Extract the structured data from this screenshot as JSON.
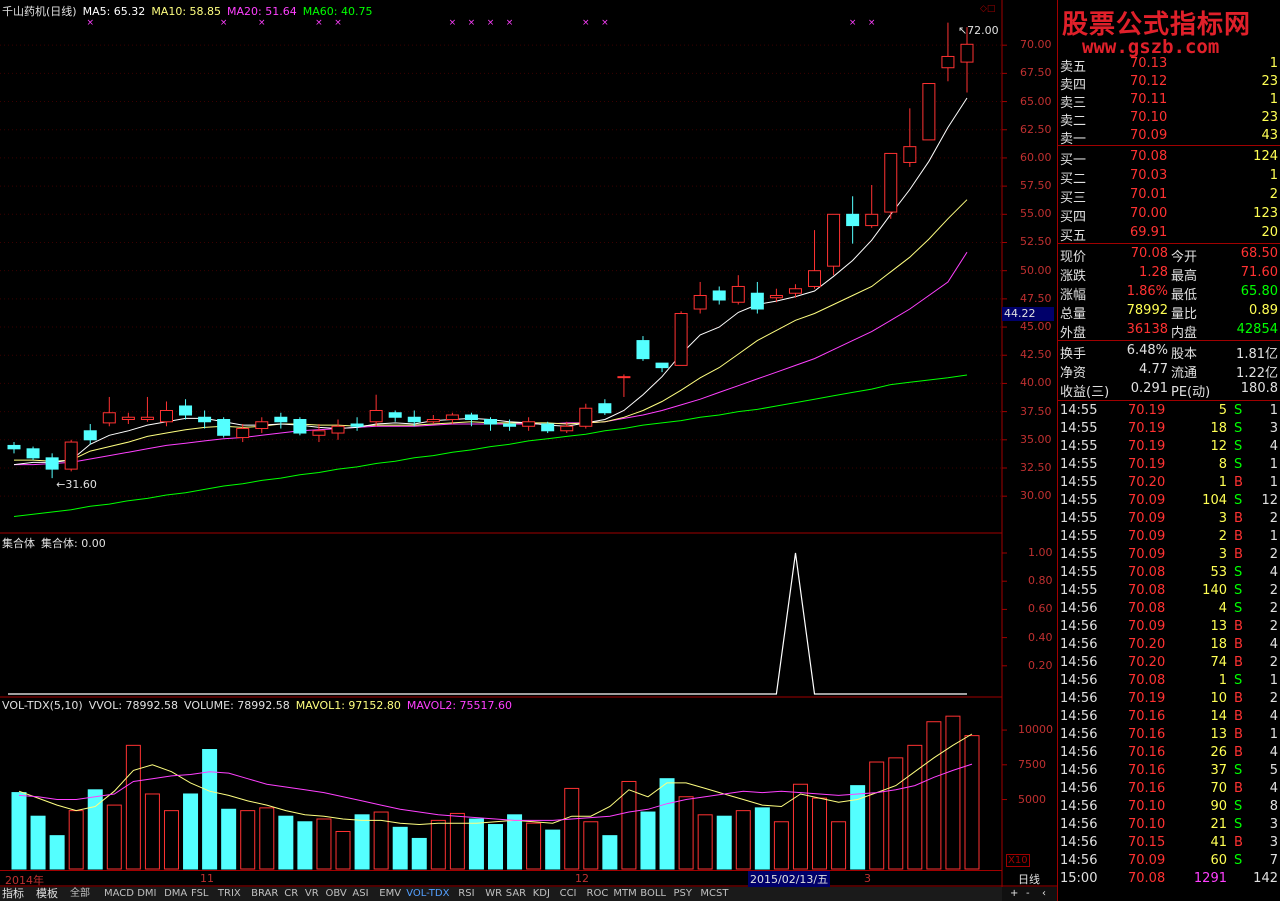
{
  "kline_header": {
    "name": "千山药机(日线)",
    "ma5": "MA5: 65.32",
    "ma10": "MA10: 58.85",
    "ma20": "MA20: 51.64",
    "ma60": "MA60: 40.75"
  },
  "high_label": "72.00",
  "low_label": "31.60",
  "cursor_price": "44.22",
  "price_ticks": [
    "70.00",
    "67.50",
    "65.00",
    "62.50",
    "60.00",
    "57.50",
    "55.00",
    "52.50",
    "50.00",
    "47.50",
    "45.00",
    "42.50",
    "40.00",
    "37.50",
    "35.00",
    "32.50",
    "30.00"
  ],
  "ind_header": {
    "name": "集合体",
    "value": "集合体: 0.00"
  },
  "ind_ticks": [
    "1.00",
    "0.80",
    "0.60",
    "0.40",
    "0.20"
  ],
  "vol_header": {
    "name": "VOL-TDX(5,10)",
    "vvol": "VVOL: 78992.58",
    "volume": "VOLUME: 78992.58",
    "mavol1": "MAVOL1: 97152.80",
    "mavol2": "MAVOL2: 75517.60"
  },
  "vol_ticks": [
    "10000",
    "7500",
    "5000"
  ],
  "vol_unit": "X10",
  "date_labels": {
    "year": "2014年",
    "m11": "11",
    "m12": "12",
    "cursor": "2015/02/13/五",
    "m3": "3"
  },
  "period": "日线",
  "watermark": {
    "line1": "股票公式指标网",
    "line2": "www.gszb.com"
  },
  "colors": {
    "up": "#ff3232",
    "down": "#54ffff",
    "ma5": "#ffffff",
    "ma10": "#ffff80",
    "ma20": "#ff40ff",
    "ma60": "#00ff00"
  },
  "sell": [
    {
      "label": "卖五",
      "price": "70.13",
      "vol": "1"
    },
    {
      "label": "卖四",
      "price": "70.12",
      "vol": "23"
    },
    {
      "label": "卖三",
      "price": "70.11",
      "vol": "1"
    },
    {
      "label": "卖二",
      "price": "70.10",
      "vol": "23"
    },
    {
      "label": "卖一",
      "price": "70.09",
      "vol": "43"
    }
  ],
  "buy": [
    {
      "label": "买一",
      "price": "70.08",
      "vol": "124"
    },
    {
      "label": "买二",
      "price": "70.03",
      "vol": "1"
    },
    {
      "label": "买三",
      "price": "70.01",
      "vol": "2"
    },
    {
      "label": "买四",
      "price": "70.00",
      "vol": "123"
    },
    {
      "label": "买五",
      "price": "69.91",
      "vol": "20"
    }
  ],
  "quote": [
    {
      "l1": "现价",
      "v1": "70.08",
      "l2": "今开",
      "v2": "68.50"
    },
    {
      "l1": "涨跌",
      "v1": "1.28",
      "l2": "最高",
      "v2": "71.60"
    },
    {
      "l1": "涨幅",
      "v1": "1.86%",
      "l2": "最低",
      "v2": "65.80"
    },
    {
      "l1": "总量",
      "v1": "78992",
      "l2": "量比",
      "v2": "0.89"
    },
    {
      "l1": "外盘",
      "v1": "36138",
      "l2": "内盘",
      "v2": "42854"
    }
  ],
  "fin": [
    {
      "l1": "换手",
      "v1": "6.48%",
      "l2": "股本",
      "v2": "1.81亿"
    },
    {
      "l1": "净资",
      "v1": "4.77",
      "l2": "流通",
      "v2": "1.22亿"
    },
    {
      "l1": "收益(三)",
      "v1": "0.291",
      "l2": "PE(动)",
      "v2": "180.8"
    }
  ],
  "ticks": [
    {
      "t": "14:55",
      "p": "70.19",
      "v": "5",
      "d": "S",
      "n": "1"
    },
    {
      "t": "14:55",
      "p": "70.19",
      "v": "18",
      "d": "S",
      "n": "3"
    },
    {
      "t": "14:55",
      "p": "70.19",
      "v": "12",
      "d": "S",
      "n": "4"
    },
    {
      "t": "14:55",
      "p": "70.19",
      "v": "8",
      "d": "S",
      "n": "1"
    },
    {
      "t": "14:55",
      "p": "70.20",
      "v": "1",
      "d": "B",
      "n": "1"
    },
    {
      "t": "14:55",
      "p": "70.09",
      "v": "104",
      "d": "S",
      "n": "12"
    },
    {
      "t": "14:55",
      "p": "70.09",
      "v": "3",
      "d": "B",
      "n": "2"
    },
    {
      "t": "14:55",
      "p": "70.09",
      "v": "2",
      "d": "B",
      "n": "1"
    },
    {
      "t": "14:55",
      "p": "70.09",
      "v": "3",
      "d": "B",
      "n": "2"
    },
    {
      "t": "14:55",
      "p": "70.08",
      "v": "53",
      "d": "S",
      "n": "4"
    },
    {
      "t": "14:55",
      "p": "70.08",
      "v": "140",
      "d": "S",
      "n": "2"
    },
    {
      "t": "14:56",
      "p": "70.08",
      "v": "4",
      "d": "S",
      "n": "2"
    },
    {
      "t": "14:56",
      "p": "70.09",
      "v": "13",
      "d": "B",
      "n": "2"
    },
    {
      "t": "14:56",
      "p": "70.20",
      "v": "18",
      "d": "B",
      "n": "4"
    },
    {
      "t": "14:56",
      "p": "70.20",
      "v": "74",
      "d": "B",
      "n": "2"
    },
    {
      "t": "14:56",
      "p": "70.08",
      "v": "1",
      "d": "S",
      "n": "1"
    },
    {
      "t": "14:56",
      "p": "70.19",
      "v": "10",
      "d": "B",
      "n": "2"
    },
    {
      "t": "14:56",
      "p": "70.16",
      "v": "14",
      "d": "B",
      "n": "4"
    },
    {
      "t": "14:56",
      "p": "70.16",
      "v": "13",
      "d": "B",
      "n": "1"
    },
    {
      "t": "14:56",
      "p": "70.16",
      "v": "26",
      "d": "B",
      "n": "4"
    },
    {
      "t": "14:56",
      "p": "70.16",
      "v": "37",
      "d": "S",
      "n": "5"
    },
    {
      "t": "14:56",
      "p": "70.16",
      "v": "70",
      "d": "B",
      "n": "4"
    },
    {
      "t": "14:56",
      "p": "70.10",
      "v": "90",
      "d": "S",
      "n": "8"
    },
    {
      "t": "14:56",
      "p": "70.10",
      "v": "21",
      "d": "S",
      "n": "3"
    },
    {
      "t": "14:56",
      "p": "70.15",
      "v": "41",
      "d": "B",
      "n": "3"
    },
    {
      "t": "14:56",
      "p": "70.09",
      "v": "60",
      "d": "S",
      "n": "7"
    },
    {
      "t": "15:00",
      "p": "70.08",
      "v": "1291",
      "d": "",
      "n": "142"
    }
  ],
  "tabs": [
    "指标",
    "模板",
    "全部",
    "MACD",
    "DMI",
    "DMA",
    "FSL",
    "TRIX",
    "BRAR",
    "CR",
    "VR",
    "OBV",
    "ASI",
    "EMV",
    "VOL-TDX",
    "RSI",
    "WR",
    "SAR",
    "KDJ",
    "CCI",
    "ROC",
    "MTM",
    "BOLL",
    "PSY",
    "MCST"
  ],
  "chart_data": {
    "type": "candlestick",
    "candles": [
      [
        34.5,
        34.2,
        34.8,
        33.8
      ],
      [
        34.2,
        33.4,
        34.4,
        33.2
      ],
      [
        33.4,
        32.4,
        33.8,
        31.6
      ],
      [
        32.4,
        34.8,
        35.0,
        32.2
      ],
      [
        35.8,
        35.0,
        36.4,
        34.6
      ],
      [
        36.5,
        37.4,
        38.8,
        36.2
      ],
      [
        36.8,
        37.0,
        37.4,
        36.4
      ],
      [
        36.8,
        37.0,
        38.8,
        36.6
      ],
      [
        36.6,
        37.6,
        38.4,
        36.2
      ],
      [
        38.0,
        37.2,
        38.6,
        36.8
      ],
      [
        37.0,
        36.6,
        37.6,
        36.0
      ],
      [
        36.8,
        35.4,
        37.0,
        35.2
      ],
      [
        35.2,
        36.0,
        36.4,
        34.8
      ],
      [
        36.0,
        36.6,
        37.0,
        35.6
      ],
      [
        37.0,
        36.6,
        37.4,
        36.0
      ],
      [
        36.8,
        35.6,
        37.0,
        35.4
      ],
      [
        35.4,
        35.8,
        36.4,
        34.8
      ],
      [
        35.6,
        36.2,
        36.8,
        35.0
      ],
      [
        36.4,
        36.2,
        37.0,
        35.8
      ],
      [
        36.6,
        37.6,
        39.0,
        36.2
      ],
      [
        37.4,
        37.0,
        37.6,
        36.6
      ],
      [
        37.0,
        36.6,
        37.6,
        36.2
      ],
      [
        36.6,
        36.8,
        37.2,
        36.4
      ],
      [
        36.8,
        37.2,
        37.4,
        36.4
      ],
      [
        37.2,
        36.8,
        37.4,
        36.2
      ],
      [
        36.8,
        36.4,
        37.0,
        35.8
      ],
      [
        36.4,
        36.2,
        36.8,
        35.8
      ],
      [
        36.2,
        36.6,
        37.0,
        35.8
      ],
      [
        36.4,
        35.8,
        36.6,
        35.6
      ],
      [
        35.8,
        36.2,
        36.6,
        35.6
      ],
      [
        36.2,
        37.8,
        38.2,
        36.0
      ],
      [
        38.2,
        37.4,
        38.6,
        37.2
      ],
      [
        40.6,
        40.6,
        40.8,
        38.8
      ],
      [
        43.8,
        42.2,
        44.2,
        42.0
      ],
      [
        41.8,
        41.4,
        41.8,
        41.0
      ],
      [
        41.6,
        46.2,
        46.4,
        41.6
      ],
      [
        46.6,
        47.8,
        49.0,
        46.2
      ],
      [
        48.2,
        47.4,
        48.6,
        47.0
      ],
      [
        47.2,
        48.6,
        49.6,
        47.0
      ],
      [
        48.0,
        46.6,
        49.0,
        46.2
      ],
      [
        47.6,
        47.8,
        48.4,
        47.2
      ],
      [
        48.0,
        48.4,
        48.8,
        47.6
      ],
      [
        48.6,
        50.0,
        53.6,
        48.4
      ],
      [
        50.4,
        55.0,
        55.0,
        49.6
      ],
      [
        55.0,
        54.0,
        56.6,
        52.4
      ],
      [
        54.0,
        55.0,
        57.6,
        53.8
      ],
      [
        55.2,
        60.4,
        60.4,
        54.6
      ],
      [
        59.6,
        61.0,
        64.4,
        59.2
      ],
      [
        61.6,
        66.6,
        66.6,
        61.6
      ],
      [
        68.0,
        69.0,
        72.0,
        66.8
      ],
      [
        68.5,
        70.08,
        71.6,
        65.8
      ]
    ],
    "volumes": [
      5500,
      3800,
      2400,
      4200,
      5700,
      4600,
      8900,
      5400,
      4200,
      5400,
      8600,
      4300,
      4200,
      4400,
      3800,
      3400,
      3600,
      2700,
      3900,
      4100,
      3000,
      2200,
      3500,
      4000,
      3600,
      3200,
      3900,
      3300,
      2800,
      5800,
      3400,
      2400,
      6300,
      4100,
      6500,
      5200,
      3900,
      3800,
      4200,
      4400,
      3400,
      6100,
      5100,
      3400,
      6000,
      7700,
      8000,
      8900,
      10600,
      11000,
      9600
    ],
    "ma5": [
      32.8,
      33.0,
      33.0,
      33.2,
      34.6,
      35.4,
      35.8,
      36.3,
      36.6,
      36.9,
      36.9,
      36.6,
      36.3,
      36.3,
      36.4,
      36.3,
      36.1,
      36.0,
      36.1,
      36.4,
      36.5,
      36.4,
      36.7,
      36.8,
      36.9,
      36.8,
      36.6,
      36.5,
      36.3,
      36.2,
      36.5,
      36.8,
      37.6,
      39.0,
      40.6,
      42.6,
      44.3,
      45.0,
      46.3,
      47.0,
      47.3,
      47.7,
      48.2,
      49.5,
      50.9,
      52.7,
      55.0,
      57.2,
      59.7,
      62.7,
      65.32
    ],
    "ma10": [
      33.2,
      33.2,
      33.1,
      33.2,
      34.0,
      34.4,
      34.8,
      35.3,
      35.6,
      35.9,
      36.1,
      36.2,
      36.1,
      36.2,
      36.4,
      36.4,
      36.3,
      36.3,
      36.2,
      36.3,
      36.3,
      36.3,
      36.4,
      36.5,
      36.6,
      36.5,
      36.5,
      36.5,
      36.5,
      36.4,
      36.5,
      36.6,
      37.0,
      37.6,
      38.4,
      39.4,
      40.5,
      41.4,
      42.6,
      43.8,
      44.7,
      45.6,
      46.2,
      47.0,
      47.8,
      48.6,
      49.9,
      51.2,
      52.8,
      54.6,
      56.3
    ],
    "ma20": [
      32.8,
      32.8,
      32.9,
      33.0,
      33.3,
      33.6,
      33.9,
      34.2,
      34.5,
      34.7,
      34.9,
      35.1,
      35.2,
      35.4,
      35.6,
      35.8,
      35.9,
      36.0,
      36.1,
      36.2,
      36.2,
      36.2,
      36.3,
      36.4,
      36.4,
      36.4,
      36.4,
      36.4,
      36.4,
      36.5,
      36.5,
      36.6,
      36.9,
      37.2,
      37.6,
      38.1,
      38.6,
      39.2,
      39.8,
      40.4,
      41.0,
      41.6,
      42.2,
      43.0,
      43.8,
      44.6,
      45.6,
      46.6,
      47.8,
      49.0,
      51.64
    ],
    "ma60": [
      28.2,
      28.4,
      28.6,
      28.8,
      29.1,
      29.3,
      29.6,
      29.8,
      30.1,
      30.3,
      30.6,
      30.9,
      31.1,
      31.4,
      31.6,
      31.9,
      32.1,
      32.4,
      32.6,
      32.9,
      33.1,
      33.4,
      33.6,
      33.9,
      34.1,
      34.4,
      34.6,
      34.9,
      35.1,
      35.3,
      35.5,
      35.8,
      36.0,
      36.3,
      36.5,
      36.7,
      37.0,
      37.2,
      37.5,
      37.7,
      38.0,
      38.3,
      38.6,
      38.9,
      39.2,
      39.5,
      39.9,
      40.1,
      40.3,
      40.5,
      40.75
    ],
    "mavol1": [
      5600,
      5100,
      4600,
      4200,
      4500,
      5600,
      7100,
      7500,
      7000,
      6200,
      5600,
      5300,
      4900,
      4600,
      4200,
      3900,
      3800,
      3600,
      3500,
      3500,
      3300,
      3200,
      3300,
      3300,
      3300,
      3400,
      3500,
      3400,
      3300,
      3800,
      3800,
      4500,
      5700,
      5200,
      6200,
      6200,
      5800,
      5400,
      5000,
      4600,
      4500,
      5400,
      5100,
      4800,
      5000,
      5500,
      6000,
      7000,
      8000,
      8900,
      9715
    ],
    "mavol2": [
      5300,
      5200,
      5000,
      5000,
      5200,
      5400,
      6300,
      6500,
      6700,
      6800,
      7000,
      6900,
      6500,
      6100,
      5900,
      5700,
      5500,
      5200,
      4900,
      4600,
      4300,
      4100,
      3900,
      3800,
      3700,
      3600,
      3500,
      3500,
      3500,
      3600,
      3700,
      3800,
      4100,
      4300,
      4700,
      5000,
      5200,
      5400,
      5600,
      5500,
      5600,
      5500,
      5400,
      5300,
      5400,
      5500,
      5700,
      6000,
      6600,
      7100,
      7551
    ],
    "indicator": {
      "peak_index": 41,
      "peak_value": 1.0,
      "other_value": 0.0
    },
    "signal_markers": [
      4,
      11,
      13,
      16,
      17,
      23,
      24,
      25,
      26,
      30,
      31,
      44,
      45
    ],
    "price_range": [
      27.0,
      72.5
    ],
    "volume_range": [
      0,
      11300
    ]
  }
}
